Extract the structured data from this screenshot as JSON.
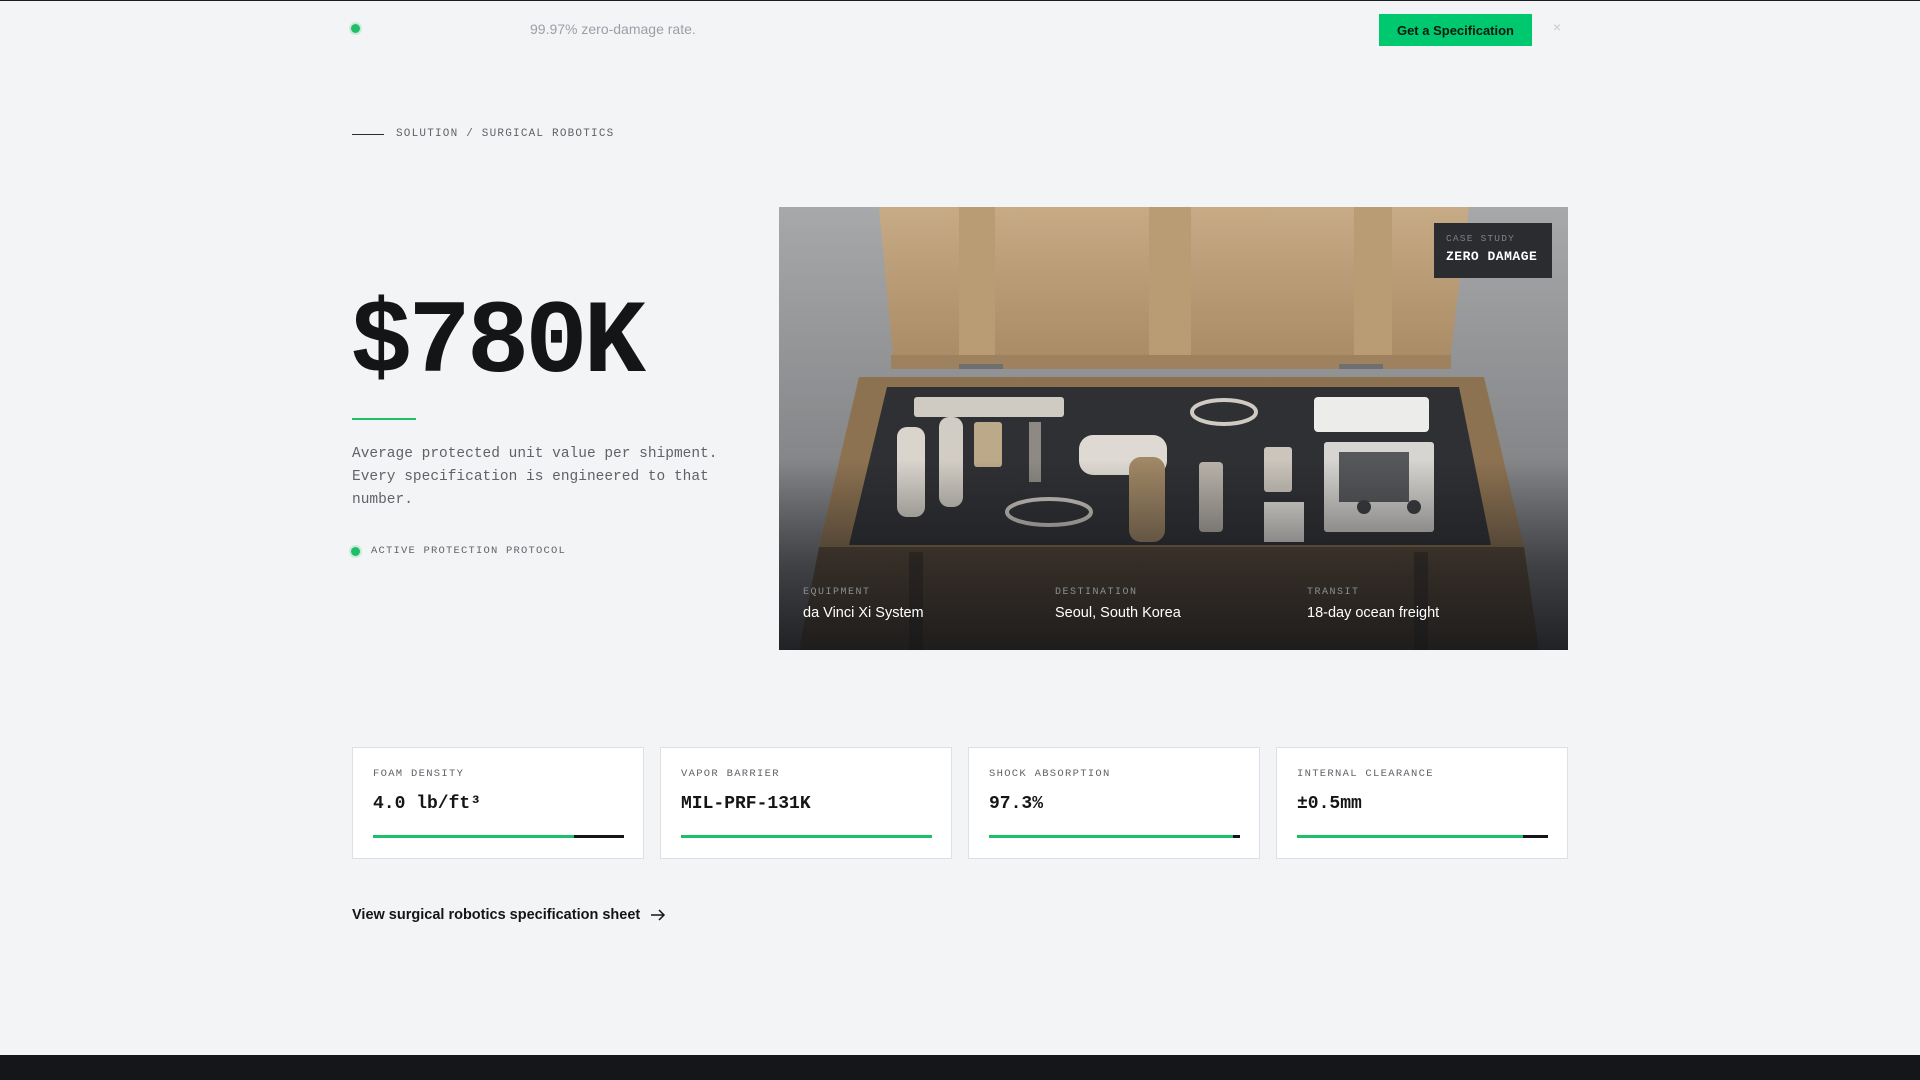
{
  "announcement": {
    "message": "99.97% zero-damage rate.",
    "cta_label": "Get a Specification",
    "close_glyph": "×"
  },
  "breadcrumb": "SOLUTION / SURGICAL ROBOTICS",
  "hero_stat": {
    "value": "$780K",
    "description": "Average protected unit value per shipment. Every specification is engineered to that number.",
    "status": "ACTIVE PROTECTION PROTOCOL"
  },
  "case_study": {
    "badge_label": "CASE STUDY",
    "badge_title": "ZERO DAMAGE",
    "meta": [
      {
        "key": "EQUIPMENT",
        "value": "da Vinci Xi System"
      },
      {
        "key": "DESTINATION",
        "value": "Seoul, South Korea"
      },
      {
        "key": "TRANSIT",
        "value": "18-day ocean freight"
      }
    ]
  },
  "specs": [
    {
      "key": "FOAM DENSITY",
      "value": "4.0 lb/ft³",
      "level": 0.8
    },
    {
      "key": "VAPOR BARRIER",
      "value": "MIL-PRF-131K",
      "level": 1.0
    },
    {
      "key": "SHOCK ABSORPTION",
      "value": "97.3%",
      "level": 0.973
    },
    {
      "key": "INTERNAL CLEARANCE",
      "value": "±0.5mm",
      "level": 0.9
    }
  ],
  "spec_link": "View surgical robotics specification sheet",
  "colors": {
    "accent": "#00c86e",
    "status_green": "#1fbf6a",
    "ink": "#141517",
    "background": "#f3f4f6"
  }
}
